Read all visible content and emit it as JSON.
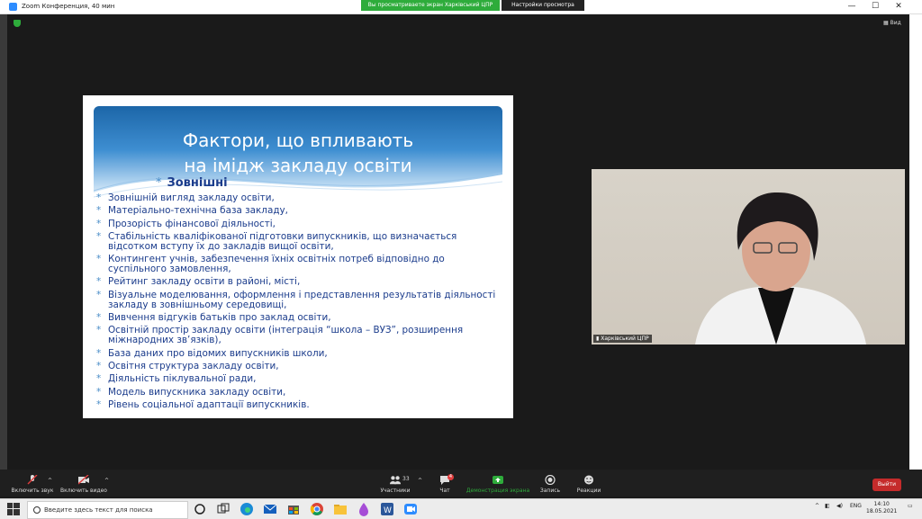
{
  "window": {
    "title": "Zoom Конференция, 40 мин",
    "share_banner": "Вы просматриваете экран Харківський ЦПР",
    "view_options": "Настройки просмотра",
    "view_label": "Вид",
    "controls": {
      "minimize": "—",
      "maximize": "☐",
      "close": "✕"
    }
  },
  "slide": {
    "title_line1": "Фактори, що впливають",
    "title_line2": "на  імідж закладу освіти",
    "subtitle": "Зовнішні",
    "items": [
      "Зовнішній вигляд  закладу освіти,",
      "Матеріально-технічна база закладу,",
      "Прозорість фінансової діяльності,",
      "Стабільність кваліфікованої підготовки випускників, що визначається відсотком вступу їх до закладів вищої освіти,",
      "Контингент учнів, забезпечення їхніх освітніх потреб відповідно до суспільного замовлення,",
      "Рейтинг  закладу освіти в районі, місті,",
      "Візуальне моделювання, оформлення і представлення результатів діяльності закладу в зовнішньому середовищі,",
      "Вивчення відгуків батьків про заклад освіти,",
      "Освітній простір закладу  освіти (інтеграція “школа – ВУЗ”, розширення міжнародних зв’язків),",
      "База даних про відомих випускників школи,",
      "Освітня структура закладу освіти,",
      "Діяльність піклувальної ради,",
      "Модель випускника закладу освіти,",
      "Рівень соціальної адаптації випускників."
    ]
  },
  "video": {
    "participant_name": "Харківський ЦПР"
  },
  "toolbar": {
    "mute": "Включить звук",
    "video": "Включить видео",
    "participants": "Участники",
    "participants_count": "33",
    "chat": "Чат",
    "chat_badge": "4",
    "share": "Демонстрация экрана",
    "record": "Запись",
    "reactions": "Реакции",
    "leave": "Выйти"
  },
  "taskbar": {
    "search_placeholder": "Введите здесь текст для поиска",
    "lang": "ENG",
    "time": "14:10",
    "date": "18.05.2021"
  },
  "colors": {
    "zoom_blue": "#2D8CFF",
    "share_green": "#2eac3b",
    "leave_red": "#c52b2b",
    "slide_text": "#1b3c8c"
  }
}
